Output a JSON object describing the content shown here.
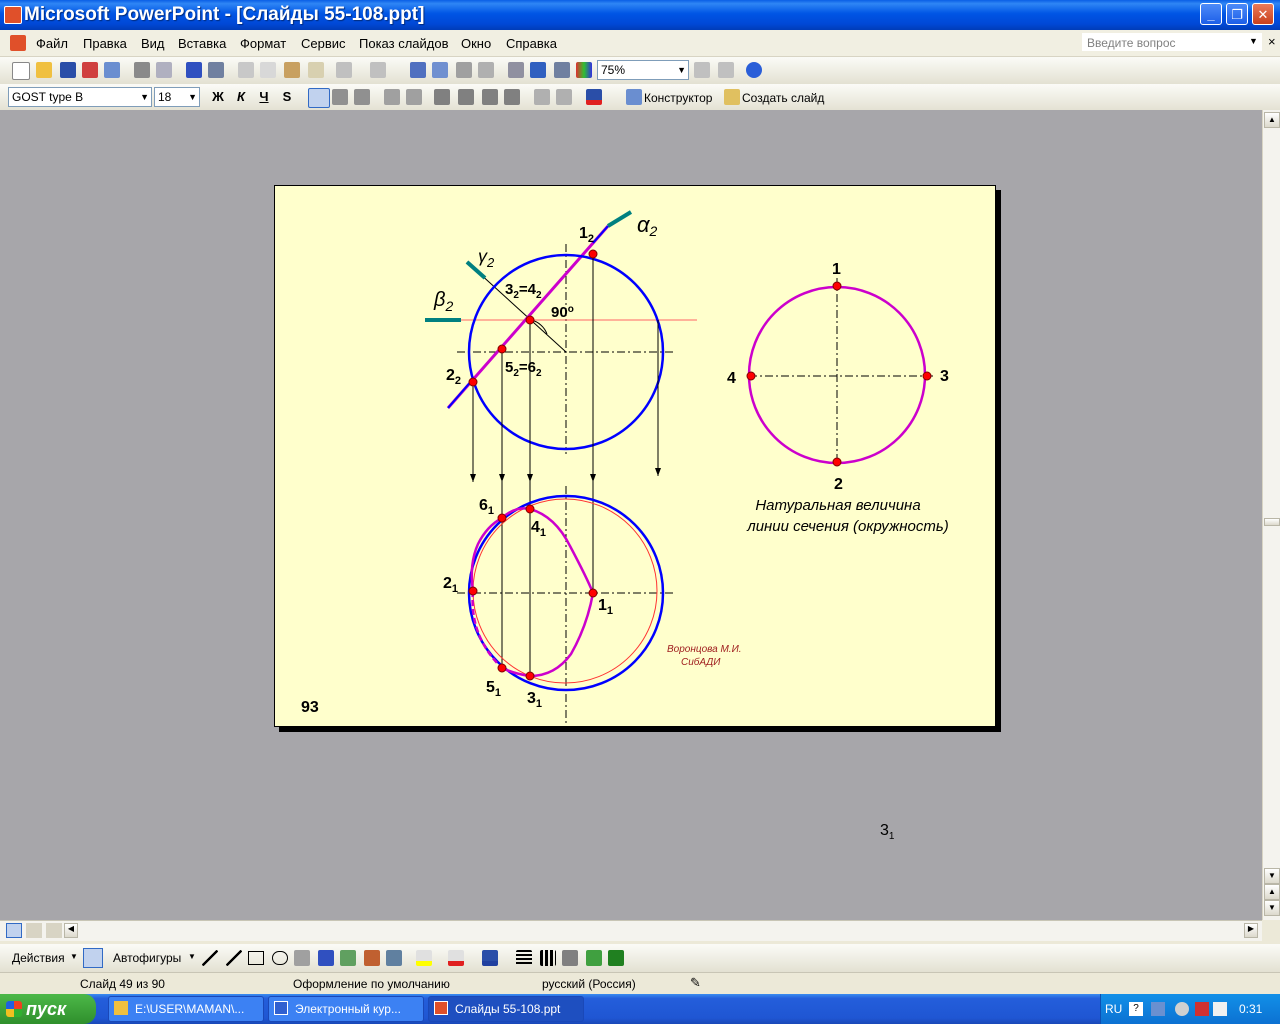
{
  "window": {
    "title": "Microsoft PowerPoint - [Слайды 55-108.ppt]"
  },
  "menu": {
    "items": [
      "Файл",
      "Правка",
      "Вид",
      "Вставка",
      "Формат",
      "Сервис",
      "Показ слайдов",
      "Окно",
      "Справка"
    ],
    "ask_placeholder": "Введите вопрос"
  },
  "toolbar": {
    "zoom": "75%"
  },
  "format_bar": {
    "font": "GOST type B",
    "size": "18",
    "bold": "Ж",
    "italic": "К",
    "underline": "Ч",
    "shadow": "S",
    "design_label": "Конструктор",
    "new_slide_label": "Создать слайд"
  },
  "slide": {
    "number": "93",
    "author_line1": "Воронцова М.И.",
    "author_line2": "СибАДИ",
    "caption_line1": "Натуральная величина",
    "caption_line2": "линии сечения (окружность)",
    "labels": {
      "alpha": "α",
      "alpha_sub": "2",
      "beta": "β",
      "beta_sub": "2",
      "gamma": "γ",
      "gamma_sub": "2",
      "p1_2": "1",
      "p1_2_sub": "2",
      "p34_2a": "3",
      "p34_2a_sub": "2",
      "p34_2eq": "=4",
      "p34_2b_sub": "2",
      "angle": "90",
      "angle_sup": "o",
      "p56_2a": "5",
      "p56_2a_sub": "2",
      "p56_2eq": "=6",
      "p56_2b_sub": "2",
      "p2_2": "2",
      "p2_2_sub": "2",
      "p6_1": "6",
      "p6_1_sub": "1",
      "p4_1": "4",
      "p4_1_sub": "1",
      "p2_1": "2",
      "p2_1_sub": "1",
      "p1_1": "1",
      "p1_1_sub": "1",
      "p5_1": "5",
      "p5_1_sub": "1",
      "p3_1": "3",
      "p3_1_sub": "1",
      "t1": "1",
      "t2": "2",
      "t3": "3",
      "t4": "4"
    },
    "colors": {
      "circle": "#0000ff",
      "section": "#cc00cc",
      "point": "#ff0000",
      "plane": "#008080",
      "bg": "#ffffcc"
    }
  },
  "notes_label": {
    "main": "3",
    "sub": "1"
  },
  "draw_bar": {
    "actions": "Действия",
    "autoshapes": "Автофигуры"
  },
  "status": {
    "slide": "Слайд 49 из 90",
    "design": "Оформление по умолчанию",
    "language": "русский (Россия)"
  },
  "taskbar": {
    "start": "пуск",
    "tasks": [
      "E:\\USER\\MAMAN\\...",
      "Электронный кур...",
      "Слайды 55-108.ppt"
    ],
    "lang": "RU",
    "clock": "0:31"
  }
}
